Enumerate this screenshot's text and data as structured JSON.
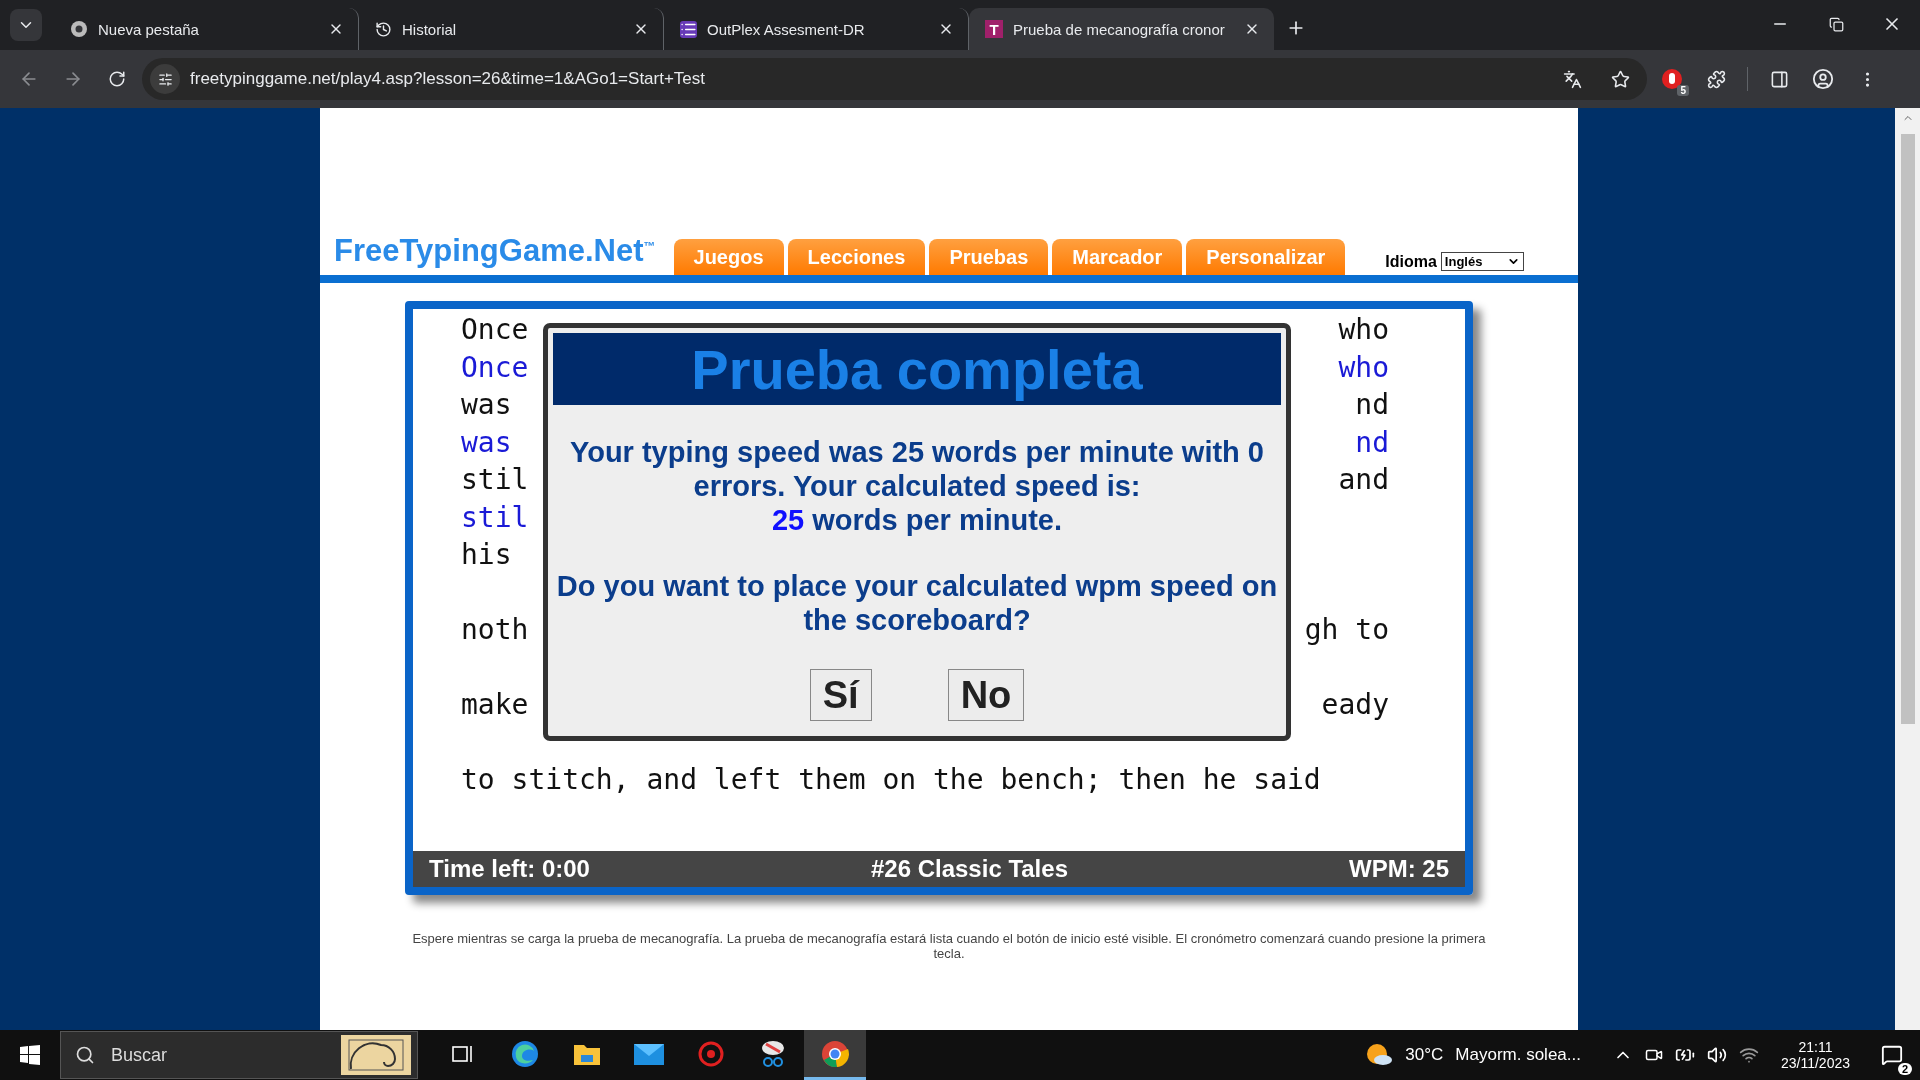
{
  "browser": {
    "tabs": [
      {
        "kind": "chrome",
        "title": "Nueva pestaña",
        "selected": false
      },
      {
        "kind": "history",
        "title": "Historial",
        "selected": false
      },
      {
        "kind": "forms",
        "title": "OutPlex Assesment-DR",
        "selected": false
      },
      {
        "kind": "typing",
        "title": "Prueba de mecanografía cronor",
        "selected": true
      }
    ],
    "tab_icon_letter": "T",
    "address": "freetypinggame.net/play4.asp?lesson=26&time=1&AGo1=Start+Test",
    "extension_badge": "5"
  },
  "site": {
    "logo": "FreeTypingGame.Net$^{™}$",
    "nav": [
      "Juegos",
      "Lecciones",
      "Pruebas",
      "Marcador",
      "Personalizar"
    ],
    "language_label": "Idioma",
    "language_value": "Inglés"
  },
  "typing_test": {
    "lines": [
      {
        "kind": "target",
        "left": "Once",
        "right": "who"
      },
      {
        "kind": "typed",
        "left": "Once",
        "right": "who"
      },
      {
        "kind": "target",
        "left": "was",
        "right": "nd"
      },
      {
        "kind": "typed",
        "left": "was",
        "right": "nd"
      },
      {
        "kind": "target",
        "left": "stil",
        "right": "and"
      },
      {
        "kind": "typed",
        "left": "stil"
      },
      {
        "kind": "target",
        "left": "his"
      },
      {
        "kind": "blank"
      },
      {
        "kind": "target",
        "left": "noth",
        "right": "gh to"
      },
      {
        "kind": "blank"
      },
      {
        "kind": "target",
        "left": "make",
        "right": "eady"
      },
      {
        "kind": "blank"
      },
      {
        "kind": "target",
        "left": "to stitch, and left them on the bench; then he said"
      }
    ],
    "status_bar": {
      "time_left": "Time left: 0:00",
      "lesson": "#26 Classic Tales",
      "wpm": "WPM: 25"
    }
  },
  "dialog": {
    "title": "Prueba completa",
    "result": "Your typing speed was 25 words per minute with 0 errors. Your calculated speed is:",
    "speed": "25",
    "speed_unit": "words per minute.",
    "question": "Do you want to place your calculated wpm speed on the scoreboard?",
    "buttons": [
      "Sí",
      "No"
    ]
  },
  "footer_note": "Espere mientras se carga la prueba de mecanografía. La prueba de mecanografía estará lista cuando el botón de inicio esté visible. El cronómetro comenzará cuando presione la primera tecla.",
  "taskbar": {
    "search_placeholder": "Buscar",
    "apps": [
      {
        "kind": "task-view",
        "selected": false
      },
      {
        "kind": "edge",
        "selected": false
      },
      {
        "kind": "explorer",
        "selected": false
      },
      {
        "kind": "mail",
        "selected": false
      },
      {
        "kind": "red-app",
        "selected": false
      },
      {
        "kind": "snipping",
        "selected": false
      },
      {
        "kind": "chrome",
        "selected": true
      }
    ],
    "temperature": "30°C",
    "weather": "Mayorm. solea...",
    "time": "21:11",
    "date": "23/11/2023",
    "notifications": "2"
  }
}
